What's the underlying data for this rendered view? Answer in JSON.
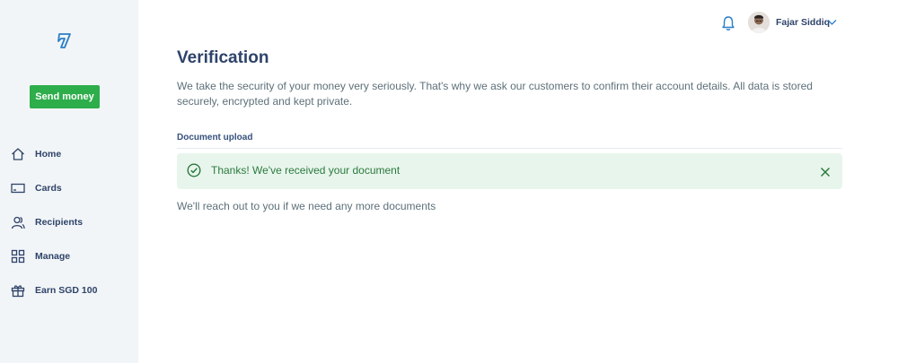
{
  "sidebar": {
    "logo": "wise-flag-logo",
    "send_button": "Send money",
    "items": [
      {
        "label": "Home",
        "icon": "home-icon"
      },
      {
        "label": "Cards",
        "icon": "card-icon"
      },
      {
        "label": "Recipients",
        "icon": "recipients-icon"
      },
      {
        "label": "Manage",
        "icon": "grid-icon"
      },
      {
        "label": "Earn SGD 100",
        "icon": "gift-icon"
      }
    ]
  },
  "header": {
    "user_name": "Fajar Siddiq",
    "bell_icon": "bell-icon",
    "accent": "#2a7ec7"
  },
  "main": {
    "title": "Verification",
    "intro": "We take the security of your money very seriously. That's why we ask our customers to confirm their account details. All data is stored securely, encrypted and kept private.",
    "section_label": "Document upload",
    "alert": {
      "text": "Thanks! We've received your document",
      "color": "#2b7a3d",
      "background": "#e8f5ec"
    },
    "followup": "We'll reach out to you if we need any more documents"
  },
  "colors": {
    "sidebar_bg": "#f2f5f7",
    "primary_button": "#2ead4b",
    "heading": "#2e4369"
  }
}
